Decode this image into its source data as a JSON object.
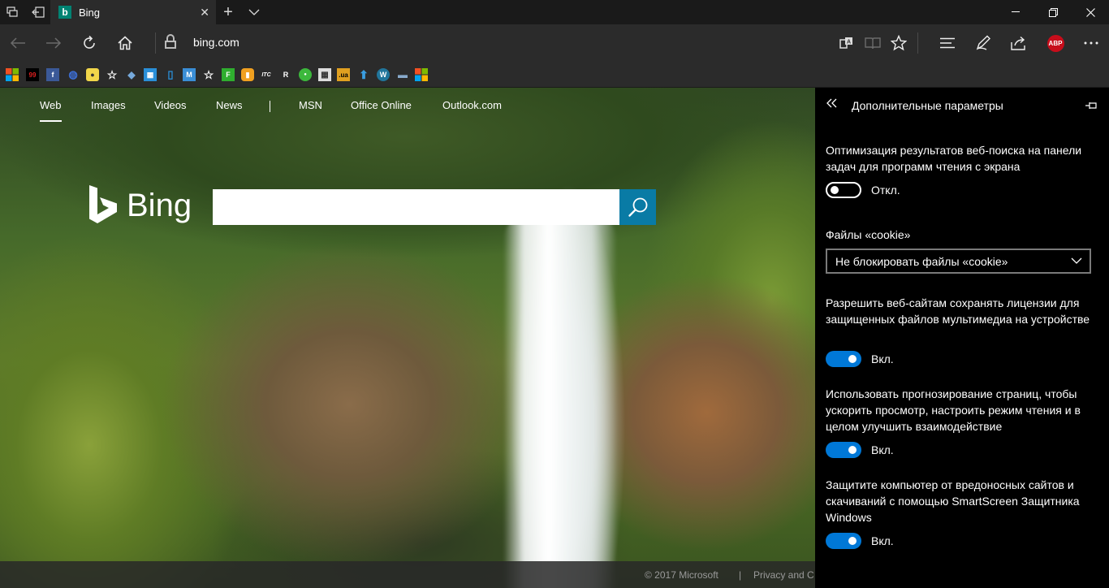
{
  "tab": {
    "title": "Bing",
    "favicon": "b"
  },
  "address": {
    "url": "bing.com"
  },
  "icons": {
    "tab_preview": "tab-preview-icon",
    "set_aside": "set-aside-icon",
    "new_tab": "+",
    "tab_list": "chevron-down-icon",
    "back": "back-arrow-icon",
    "forward": "forward-arrow-icon",
    "refresh": "refresh-icon",
    "home": "home-icon",
    "reading_view": "reading-view-icon",
    "favorite": "star-icon",
    "hub": "hub-icon",
    "notes": "pen-icon",
    "share": "share-icon",
    "more": "more-icon"
  },
  "abp_label": "ABP",
  "bing": {
    "nav": [
      "Web",
      "Images",
      "Videos",
      "News",
      "MSN",
      "Office Online",
      "Outlook.com"
    ],
    "logo_text": "Bing",
    "footer_copyright": "© 2017 Microsoft",
    "footer_sep": "|",
    "footer_privacy": "Privacy and C"
  },
  "panel": {
    "title": "Дополнительные параметры",
    "settings": [
      {
        "label": "Оптимизация результатов веб-поиска на панели задач для программ чтения с экрана",
        "state": "Откл.",
        "on": false
      },
      {
        "label": "Разрешить веб-сайтам сохранять лицензии для защищенных файлов мультимедиа на устройстве",
        "state": "Вкл.",
        "on": true
      },
      {
        "label": "Использовать прогнозирование страниц, чтобы ускорить просмотр, настроить режим чтения и в целом улучшить взаимодействие",
        "state": "Вкл.",
        "on": true
      },
      {
        "label": "Защитите компьютер от вредоносных сайтов и скачиваний с помощью SmartScreen Защитника Windows",
        "state": "Вкл.",
        "on": true
      }
    ],
    "cookies": {
      "label": "Файлы «cookie»",
      "value": "Не блокировать файлы «cookie»"
    }
  },
  "colors": {
    "accent": "#0078d7",
    "bing_search": "#097ba5",
    "panel_bg": "#000000",
    "chrome_bg": "#2b2b2b"
  }
}
